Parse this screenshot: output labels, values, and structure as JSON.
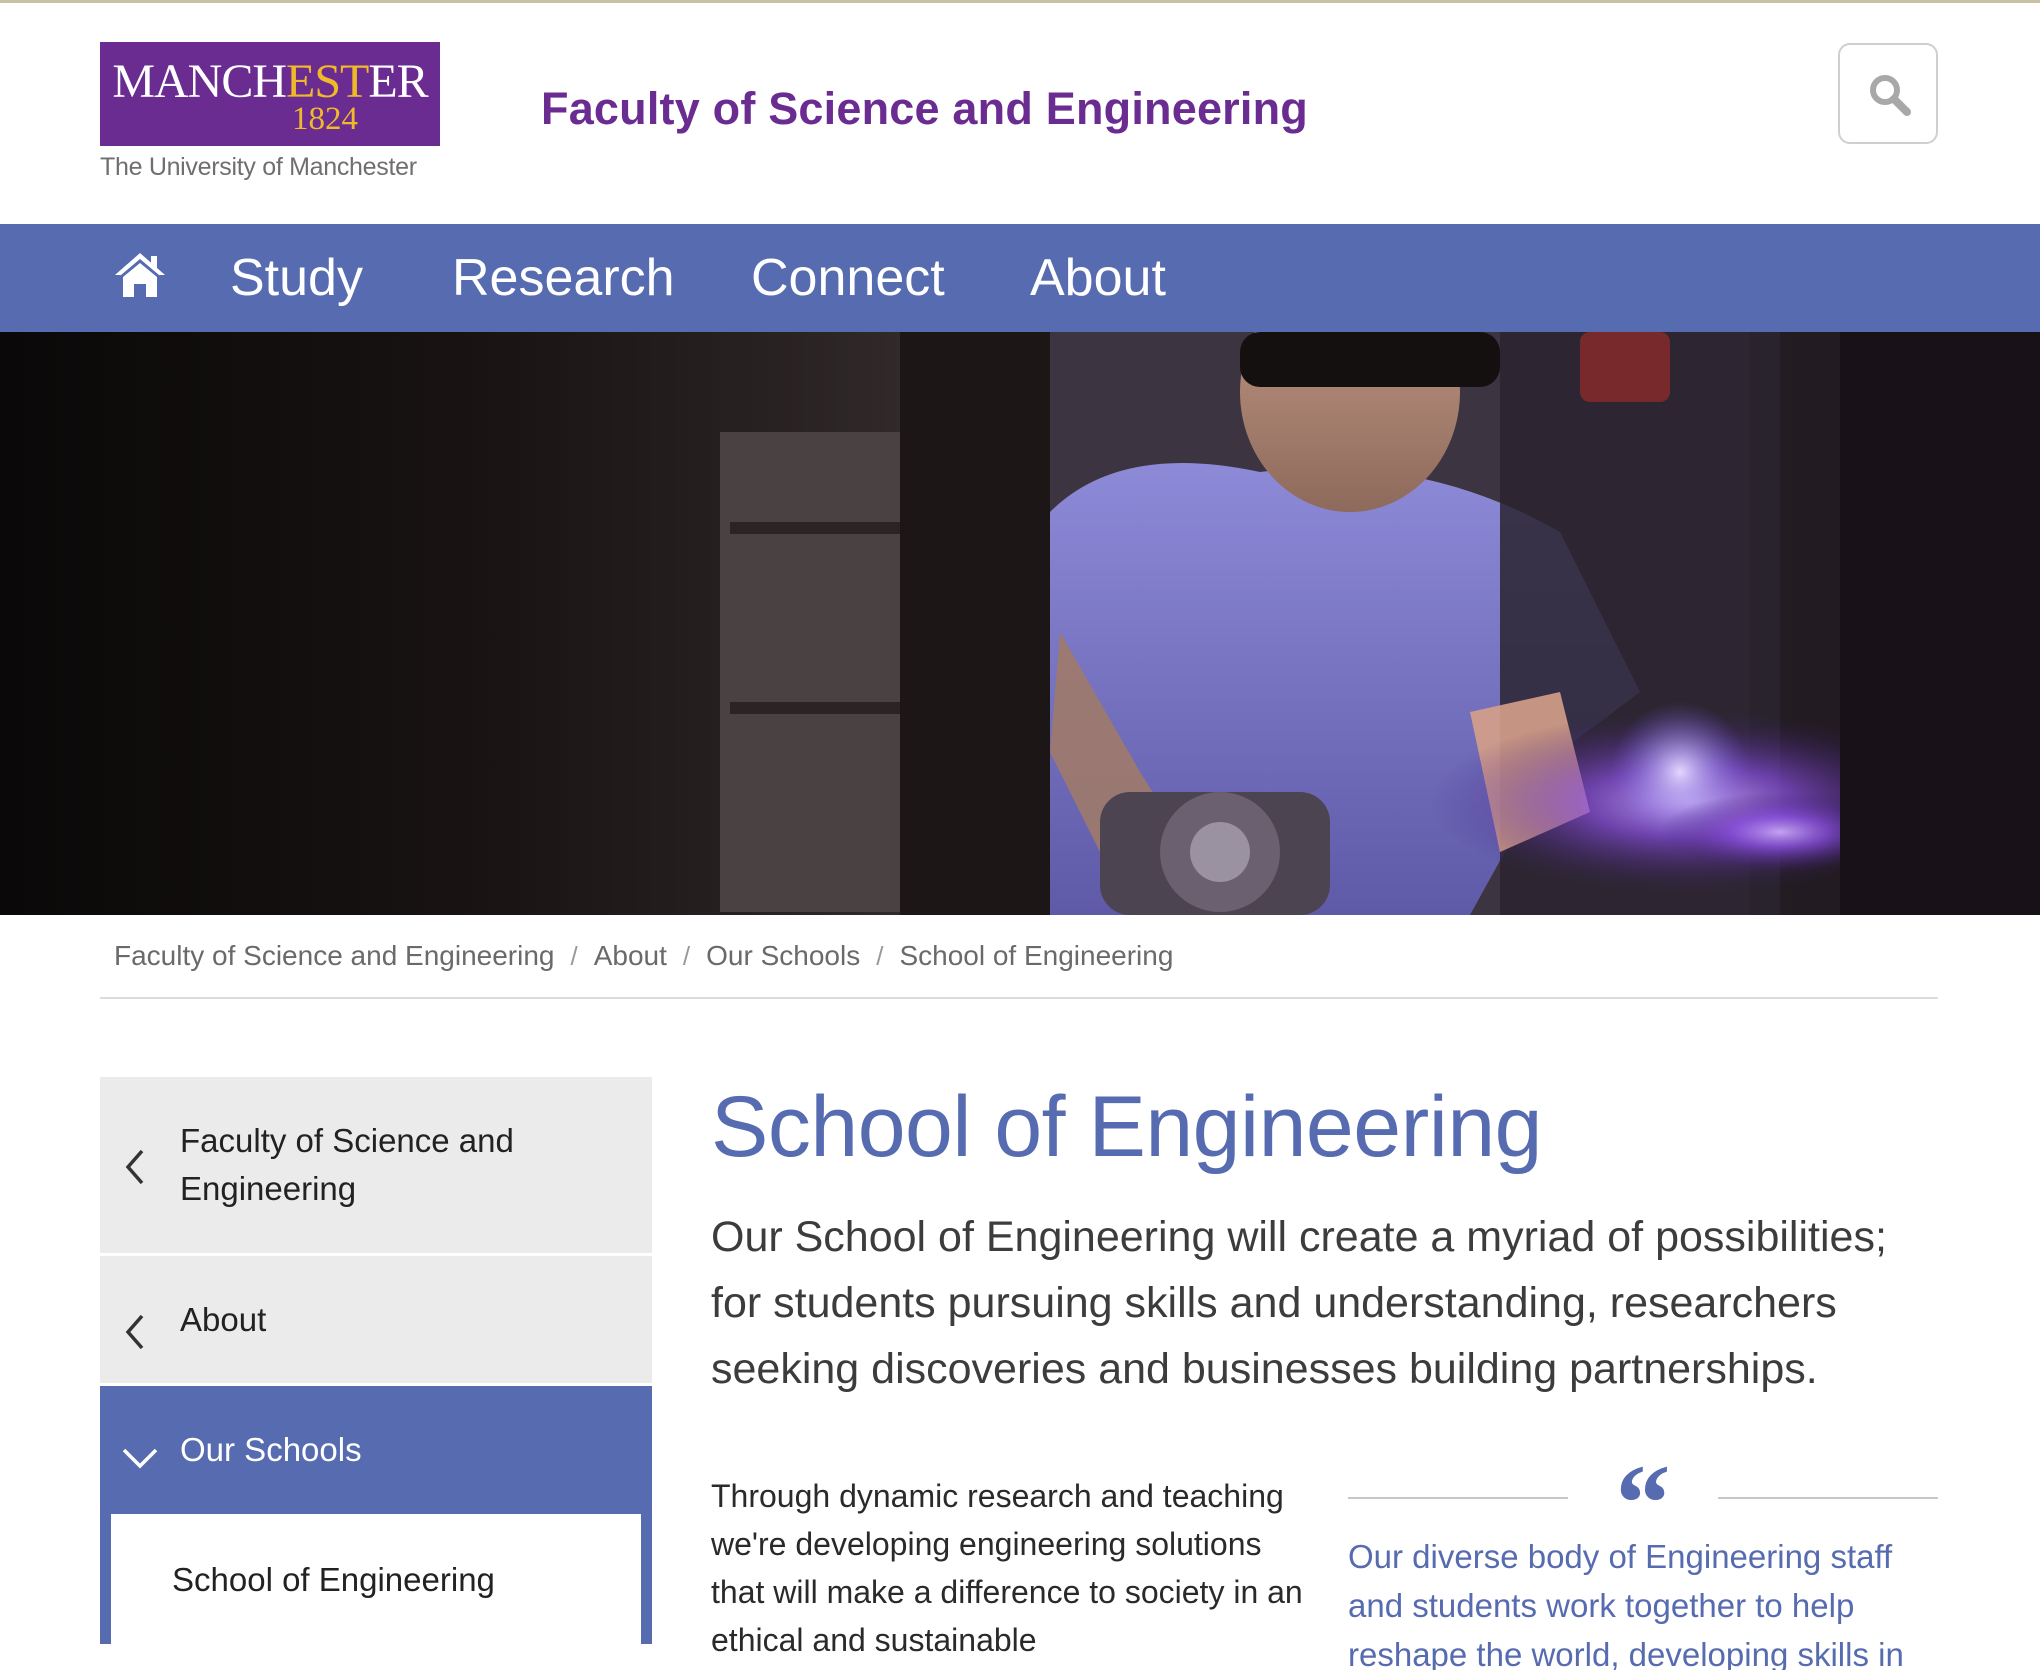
{
  "header": {
    "logo": {
      "word_part1": "MANCH",
      "word_gold": "EST",
      "word_part2": "ER",
      "year": "1824",
      "subtitle": "The University of Manchester"
    },
    "faculty_title": "Faculty of Science and Engineering",
    "search_icon": "search-icon"
  },
  "nav": {
    "home_icon": "home-icon",
    "items": [
      {
        "label": "Study"
      },
      {
        "label": "Research"
      },
      {
        "label": "Connect"
      },
      {
        "label": "About"
      }
    ]
  },
  "hero": {
    "description": "photo"
  },
  "breadcrumb": [
    {
      "label": "Faculty of Science and Engineering"
    },
    {
      "label": "About"
    },
    {
      "label": "Our Schools"
    },
    {
      "label": "School of Engineering"
    }
  ],
  "breadcrumb_separator": "/",
  "sidebar": {
    "items": [
      {
        "label": "Faculty of Science and Engineering",
        "icon": "chevron-left-icon"
      },
      {
        "label": "About",
        "icon": "chevron-left-icon"
      },
      {
        "label": "Our Schools",
        "icon": "chevron-down-icon"
      }
    ],
    "sub_item": {
      "label": "School of Engineering"
    }
  },
  "main": {
    "title": "School of Engineering",
    "intro": "Our School of Engineering will create a myriad of possibilities; for students pursuing skills and understanding, researchers seeking discoveries and businesses building partnerships.",
    "body": "Through dynamic research and teaching we're developing engineering solutions that will make a difference to society in an ethical and sustainable",
    "quote_mark": "“",
    "quote": "Our diverse body of Engineering staff and students work together to help reshape the world, developing skills in"
  },
  "colors": {
    "brand_purple": "#6a2c91",
    "brand_gold": "#f0b92a",
    "accent_blue": "#566bb0"
  }
}
